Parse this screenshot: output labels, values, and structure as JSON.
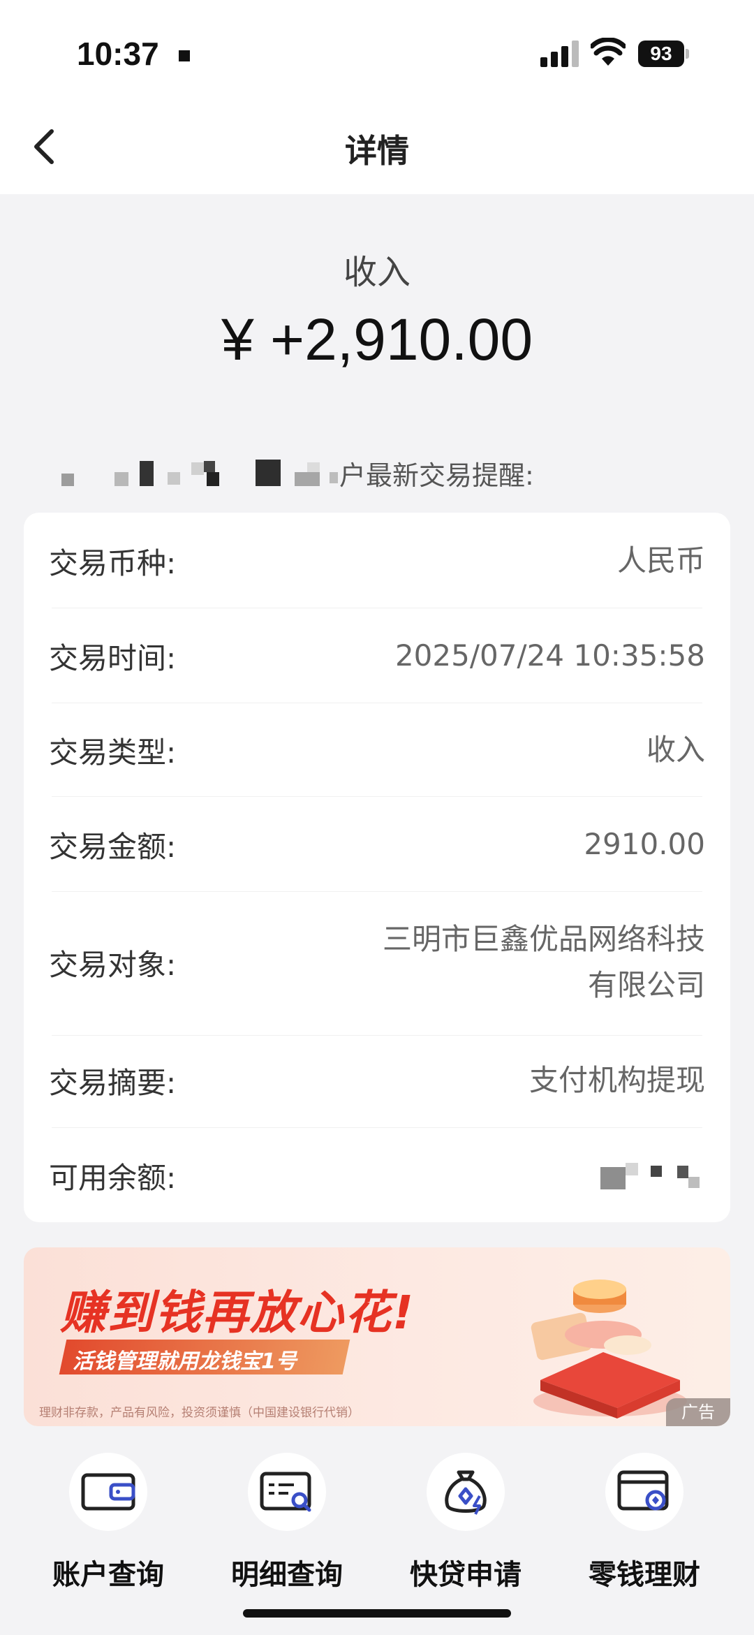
{
  "status_bar": {
    "time": "10:37",
    "battery": "93"
  },
  "nav": {
    "title": "详情"
  },
  "summary": {
    "label": "收入",
    "amount": "¥ +2,910.00"
  },
  "notice": {
    "text": "户最新交易提醒:"
  },
  "details": [
    {
      "label": "交易币种:",
      "value": "人民币"
    },
    {
      "label": "交易时间:",
      "value": "2025/07/24 10:35:58"
    },
    {
      "label": "交易类型:",
      "value": "收入"
    },
    {
      "label": "交易金额:",
      "value": "2910.00"
    },
    {
      "label": "交易对象:",
      "value_line1": "三明市巨鑫优品网络科技",
      "value_line2": "有限公司"
    },
    {
      "label": "交易摘要:",
      "value": "支付机构提现"
    },
    {
      "label": "可用余额:",
      "value": ""
    }
  ],
  "ad": {
    "headline": "赚到钱再放心花!",
    "subline": "活钱管理就用龙钱宝1号",
    "disclaimer": "理财非存款，产品有风险，投资须谨慎（中国建设银行代销）",
    "tag": "广告"
  },
  "quick_actions": [
    {
      "label": "账户查询",
      "icon": "wallet-icon"
    },
    {
      "label": "明细查询",
      "icon": "statement-search-icon"
    },
    {
      "label": "快贷申请",
      "icon": "money-bag-icon"
    },
    {
      "label": "零钱理财",
      "icon": "card-coin-icon"
    }
  ],
  "colors": {
    "background": "#f3f3f5",
    "ad_red": "#e63223",
    "icon_blue": "#3a4fc7"
  }
}
